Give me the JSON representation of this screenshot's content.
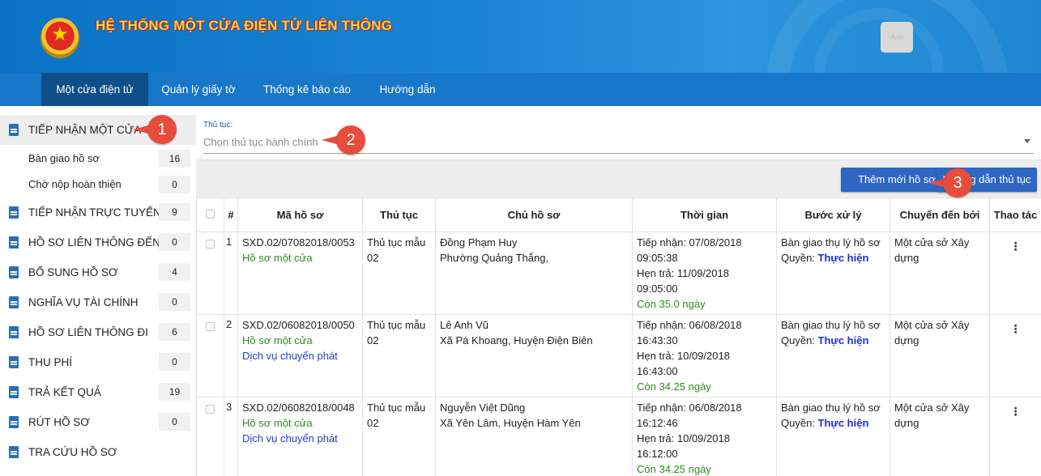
{
  "header": {
    "title": "HỆ THỐNG MỘT CỬA ĐIỆN TỬ LIÊN THÔNG",
    "avatar_text": "Ảnh"
  },
  "nav": [
    {
      "label": "Một cửa điện tử",
      "active": true
    },
    {
      "label": "Quản lý giấy tờ"
    },
    {
      "label": "Thống kê báo cáo"
    },
    {
      "label": "Hướng dẫn"
    }
  ],
  "sidebar": {
    "items": [
      {
        "label": "TIẾP NHẬN MỘT CỬA",
        "count": "",
        "active": true
      },
      {
        "label": "Bàn giao hồ sơ",
        "count": "16",
        "sub": true
      },
      {
        "label": "Chờ nộp hoàn thiện",
        "count": "0",
        "sub": true
      },
      {
        "label": "TIẾP NHẬN TRỰC TUYẾN",
        "count": "9"
      },
      {
        "label": "HỒ SƠ LIÊN THÔNG ĐẾN",
        "count": "0"
      },
      {
        "label": "BỔ SUNG HỒ SƠ",
        "count": "4"
      },
      {
        "label": "NGHĨA VỤ TÀI CHÍNH",
        "count": "0"
      },
      {
        "label": "HỒ SƠ LIÊN THÔNG ĐI",
        "count": "6"
      },
      {
        "label": "THU PHÍ",
        "count": "0"
      },
      {
        "label": "TRẢ KẾT QUẢ",
        "count": "19"
      },
      {
        "label": "RÚT HỒ SƠ",
        "count": "0"
      },
      {
        "label": "TRA CỨU HỒ SƠ",
        "count": ""
      }
    ]
  },
  "procedure": {
    "label": "Thủ tục:",
    "placeholder": "Chọn thủ tục hành chính"
  },
  "toolbar": {
    "add_label": "Thêm mới hồ sơ",
    "guide_label": "Hướng dẫn thủ tục"
  },
  "table": {
    "headers": [
      "",
      "#",
      "Mã hồ sơ",
      "Thủ tục",
      "Chủ hồ sơ",
      "Thời gian",
      "Bước xử lý",
      "Chuyển đến bởi",
      "Thao tác"
    ],
    "rows": [
      {
        "num": "1",
        "code": "SXD.02/07082018/0053",
        "type": "Hồ sơ một cửa",
        "delivery": "",
        "procedure": "Thủ tục mẫu 02",
        "owner": "Đồng Phạm Huy",
        "address": "Phường Quảng Thắng,",
        "received": "Tiếp nhận: 07/08/2018 09:05:38",
        "due": "Hẹn trả: 11/09/2018 09:05:00",
        "remaining": "Còn 35.0 ngày",
        "step": "Bàn giao thụ lý hồ sơ",
        "role_prefix": "Quyền:",
        "role": "Thực hiện",
        "from": "Một cửa sở Xây dựng"
      },
      {
        "num": "2",
        "code": "SXD.02/06082018/0050",
        "type": "Hồ sơ một cửa",
        "delivery": "Dịch vụ chuyển phát",
        "procedure": "Thủ tục mẫu 02",
        "owner": "Lê Anh Vũ",
        "address": "Xã Pá Khoang, Huyện Điện Biên",
        "received": "Tiếp nhận: 06/08/2018 16:43:30",
        "due": "Hẹn trả: 10/09/2018 16:43:00",
        "remaining": "Còn 34.25 ngày",
        "step": "Bàn giao thụ lý hồ sơ",
        "role_prefix": "Quyền:",
        "role": "Thực hiện",
        "from": "Một cửa sở Xây dựng"
      },
      {
        "num": "3",
        "code": "SXD.02/06082018/0048",
        "type": "Hồ sơ một cửa",
        "delivery": "Dịch vụ chuyển phát",
        "procedure": "Thủ tục mẫu 02",
        "owner": "Nguyễn Việt Dũng",
        "address": "Xã Yên Lâm, Huyện Hàm Yên",
        "received": "Tiếp nhận: 06/08/2018 16:12:46",
        "due": "Hẹn trả: 10/09/2018 16:12:00",
        "remaining": "Còn 34.25 ngày",
        "step": "Bàn giao thụ lý hồ sơ",
        "role_prefix": "Quyền:",
        "role": "Thực hiện",
        "from": "Một cửa sở Xây dựng"
      }
    ]
  },
  "callouts": [
    "1",
    "2",
    "3"
  ],
  "colors": {
    "header": "#1a84d4",
    "nav": "#1777c8",
    "nav_active": "#0e4f8a",
    "button": "#2e67c3",
    "callout": "#e74c3c",
    "status_green": "#2e8b20"
  }
}
